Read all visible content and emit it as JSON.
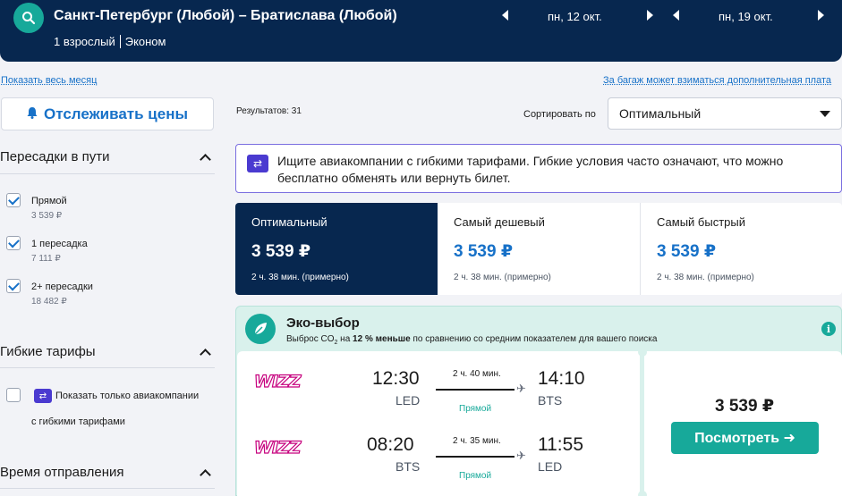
{
  "header": {
    "route": "Санкт-Петербург (Любой) – Братислава (Любой)",
    "passengers": "1 взрослый",
    "cabin": "Эконом",
    "date_out": "пн, 12 окт.",
    "date_back": "пн, 19 окт.",
    "colors": {
      "background": "#07274f",
      "accent": "#17a99a"
    }
  },
  "links": {
    "whole_month": "Показать весь месяц",
    "baggage": "За багаж может взиматься дополнительная плата"
  },
  "sidebar": {
    "track_button": "Отслеживать цены",
    "stops": {
      "title": "Пересадки в пути",
      "options": [
        {
          "label": "Прямой",
          "price": "3 539 ₽",
          "checked": true
        },
        {
          "label": "1 пересадка",
          "price": "7 111 ₽",
          "checked": true
        },
        {
          "label": "2+ пересадки",
          "price": "18 482 ₽",
          "checked": true
        }
      ]
    },
    "flexible": {
      "title": "Гибкие тарифы",
      "option_line1": "Показать только авиакомпании",
      "option_line2": "с гибкими тарифами",
      "checked": false
    },
    "departure": {
      "title": "Время отправления"
    }
  },
  "results": {
    "count": "Результатов: 31",
    "sort_label": "Сортировать по",
    "sort_value": "Оптимальный"
  },
  "banner": {
    "text": "Ищите авиакомпании с гибкими тарифами. Гибкие условия часто означают, что можно бесплатно обменять или вернуть билет."
  },
  "tabs": [
    {
      "name": "Оптимальный",
      "price": "3 539 ₽",
      "duration": "2 ч. 38 мин. (примерно)",
      "active": true
    },
    {
      "name": "Самый дешевый",
      "price": "3 539 ₽",
      "duration": "2 ч. 38 мин. (примерно)",
      "active": false
    },
    {
      "name": "Самый быстрый",
      "price": "3 539 ₽",
      "duration": "2 ч. 38 мин. (примерно)",
      "active": false
    }
  ],
  "eco": {
    "title": "Эко-выбор",
    "desc_a": "Выброс CO",
    "desc_sub": "2",
    "desc_b": " на ",
    "desc_bold": "12 % меньше",
    "desc_c": " по сравнению со средним показателем для вашего поиска"
  },
  "ticket": {
    "airline_logo_text": "WIZZ",
    "legs": [
      {
        "dep_time": "12:30",
        "dep_code": "LED",
        "duration": "2 ч. 40 мин.",
        "stops": "Прямой",
        "arr_time": "14:10",
        "arr_code": "BTS"
      },
      {
        "dep_time": "08:20",
        "dep_code": "BTS",
        "duration": "2 ч. 35 мин.",
        "stops": "Прямой",
        "arr_time": "11:55",
        "arr_code": "LED"
      }
    ],
    "price": "3 539 ₽",
    "view_button": "Посмотреть ➜"
  }
}
